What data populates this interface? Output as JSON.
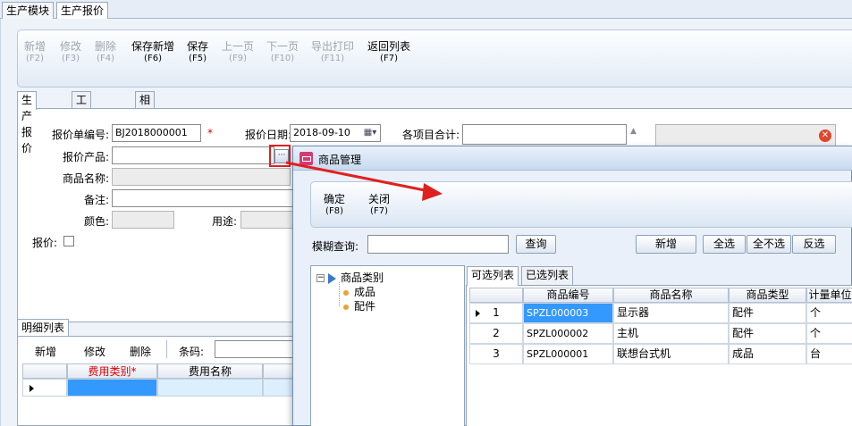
{
  "top_tabs": [
    "生产模块",
    "生产报价"
  ],
  "toolbar": [
    {
      "label": "新增",
      "key": "(F2)",
      "disabled": true
    },
    {
      "label": "修改",
      "key": "(F3)",
      "disabled": true
    },
    {
      "label": "删除",
      "key": "(F4)",
      "disabled": true
    },
    {
      "label": "保存新增",
      "key": "(F6)",
      "disabled": false
    },
    {
      "label": "保存",
      "key": "(F5)",
      "disabled": false
    },
    {
      "label": "上一页",
      "key": "(F9)",
      "disabled": true
    },
    {
      "label": "下一页",
      "key": "(F10)",
      "disabled": true
    },
    {
      "label": "导出打印",
      "key": "(F11)",
      "disabled": true
    },
    {
      "label": "返回列表",
      "key": "(F7)",
      "disabled": false
    }
  ],
  "form_tabs": [
    "生产报价",
    "工作台详情",
    "相关附件"
  ],
  "form": {
    "quote_no_label": "报价单编号:",
    "quote_no_value": "BJ2018000001",
    "required_mark": "*",
    "quote_date_label": "报价日期:",
    "quote_date_value": "2018-09-10",
    "total_label": "各项目合计:",
    "product_label": "报价产品:",
    "product_name_label": "商品名称:",
    "remark_label": "备注:",
    "color_label": "颜色:",
    "usage_label": "用途:",
    "quote_check_label": "报价:"
  },
  "detail": {
    "tab": "明细列表",
    "buttons": [
      "新增",
      "修改",
      "删除"
    ],
    "barcode_label": "条码:",
    "columns": [
      "费用类别*",
      "费用名称"
    ]
  },
  "dialog": {
    "title": "商品管理",
    "toolbar": [
      {
        "label": "确定",
        "key": "(F8)"
      },
      {
        "label": "关闭",
        "key": "(F7)"
      }
    ],
    "search_label": "模糊查询:",
    "search_button": "查询",
    "add_button": "新增",
    "select_all": "全选",
    "select_none": "全不选",
    "invert": "反选",
    "tree": {
      "root": "商品类别",
      "children": [
        "成品",
        "配件"
      ]
    },
    "list_tabs": [
      "可选列表",
      "已选列表"
    ],
    "columns": [
      "商品编号",
      "商品名称",
      "商品类型",
      "计量单位"
    ],
    "rows": [
      {
        "no": "1",
        "code": "SPZL000003",
        "name": "显示器",
        "type": "配件",
        "unit": "个"
      },
      {
        "no": "2",
        "code": "SPZL000002",
        "name": "主机",
        "type": "配件",
        "unit": "个"
      },
      {
        "no": "3",
        "code": "SPZL000001",
        "name": "联想台式机",
        "type": "成品",
        "unit": "台"
      }
    ]
  },
  "colors": {
    "highlight_red": "#e02020",
    "selection_blue": "#3399ff",
    "required_red": "#d40000"
  }
}
